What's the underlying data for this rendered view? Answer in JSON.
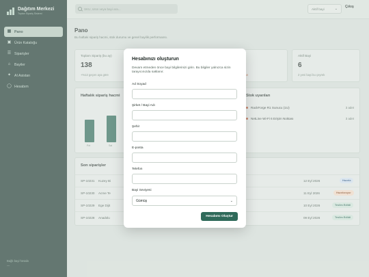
{
  "sidebar": {
    "title": "Dağıtım Merkezi",
    "subtitle": "Toptan Sipariş Sistemi",
    "items": [
      {
        "label": "Pano",
        "icon": "grid-icon",
        "active": true
      },
      {
        "label": "Ürün Kataloğu",
        "icon": "box-icon",
        "active": false
      },
      {
        "label": "Siparişler",
        "icon": "list-icon",
        "active": false
      },
      {
        "label": "Bayiler",
        "icon": "store-icon",
        "active": false
      },
      {
        "label": "AI Asistan",
        "icon": "chat-icon",
        "active": false
      },
      {
        "label": "Hesabım",
        "icon": "user-icon",
        "active": false
      }
    ],
    "footer_label": "Bağlı bayi hesabı",
    "footer_value": "—"
  },
  "topbar": {
    "search_placeholder": "SKU, ürün veya bayi ara...",
    "dealer_select": "Aktif bayi",
    "logout": "Çıkış"
  },
  "main": {
    "title": "Pano",
    "subtitle": "Bu haftaki sipariş hacmi, stok durumu ve genel bayilik performansı.",
    "stats": [
      {
        "label": "Toplam Sipariş (bu ay)",
        "value": "138",
        "note": "+%12 geçen aya göre"
      },
      {
        "label": "",
        "value": "",
        "note": ""
      },
      {
        "label": "",
        "value": "",
        "note": "uyarı"
      },
      {
        "label": "Aktif Bayi",
        "value": "6",
        "note": "2 yeni bayi bu çeyrek"
      }
    ],
    "chart_title": "Haftalık sipariş hacmi",
    "chart_bars": [
      {
        "label": "Pzt"
      },
      {
        "label": "Sal"
      }
    ],
    "stock_title": "Stok uyarıları",
    "stock_items": [
      {
        "name": "RackForge R1 Sunucu (1U)",
        "qty": "3 adet"
      },
      {
        "name": "NetLine Wi-Fi 6 Erişim Noktası",
        "qty": "3 adet"
      }
    ],
    "orders_title": "Son siparişler",
    "orders": [
      {
        "id": "SP-10231",
        "dealer": "Kuzey Bi",
        "date": "12 Eyl 2026",
        "status": "Hazırla",
        "status_color": "#d6e3f3",
        "status_text": "#2c5787"
      },
      {
        "id": "SP-10230",
        "dealer": "Acme Te",
        "date": "11 Eyl 2026",
        "status": "Hazırlanıyor",
        "status_color": "#f6dcc8",
        "status_text": "#8a4a20"
      },
      {
        "id": "SP-10229",
        "dealer": "Ege Dijit",
        "date": "10 Eyl 2026",
        "status": "Teslim Edildi",
        "status_color": "#d3e6dc",
        "status_text": "#2f6a5a"
      },
      {
        "id": "SP-10228",
        "dealer": "Anadolu",
        "date": "09 Eyl 2026",
        "status": "Teslim Edildi",
        "status_color": "#d3e6dc",
        "status_text": "#2f6a5a"
      }
    ]
  },
  "modal": {
    "title": "Hesabınızı oluşturun",
    "description": "Devam etmeden önce bayi bilgilerinizi girin. Bu bilgiler yalnızca sizin tarayıcınızda saklanır.",
    "fields": [
      {
        "label": "Ad Soyad",
        "value": ""
      },
      {
        "label": "Şirket / Bayi Adı",
        "value": ""
      },
      {
        "label": "Şehir",
        "value": ""
      },
      {
        "label": "E-posta",
        "value": ""
      },
      {
        "label": "Telefon",
        "value": ""
      }
    ],
    "tier_label": "Bayi Seviyesi",
    "tier_value": "Gümüş",
    "submit": "Hesabımı Oluştur"
  },
  "colors": {
    "sidebar": "#1f3a32",
    "accent": "#2f6a5a",
    "alert": "#b8502e"
  }
}
